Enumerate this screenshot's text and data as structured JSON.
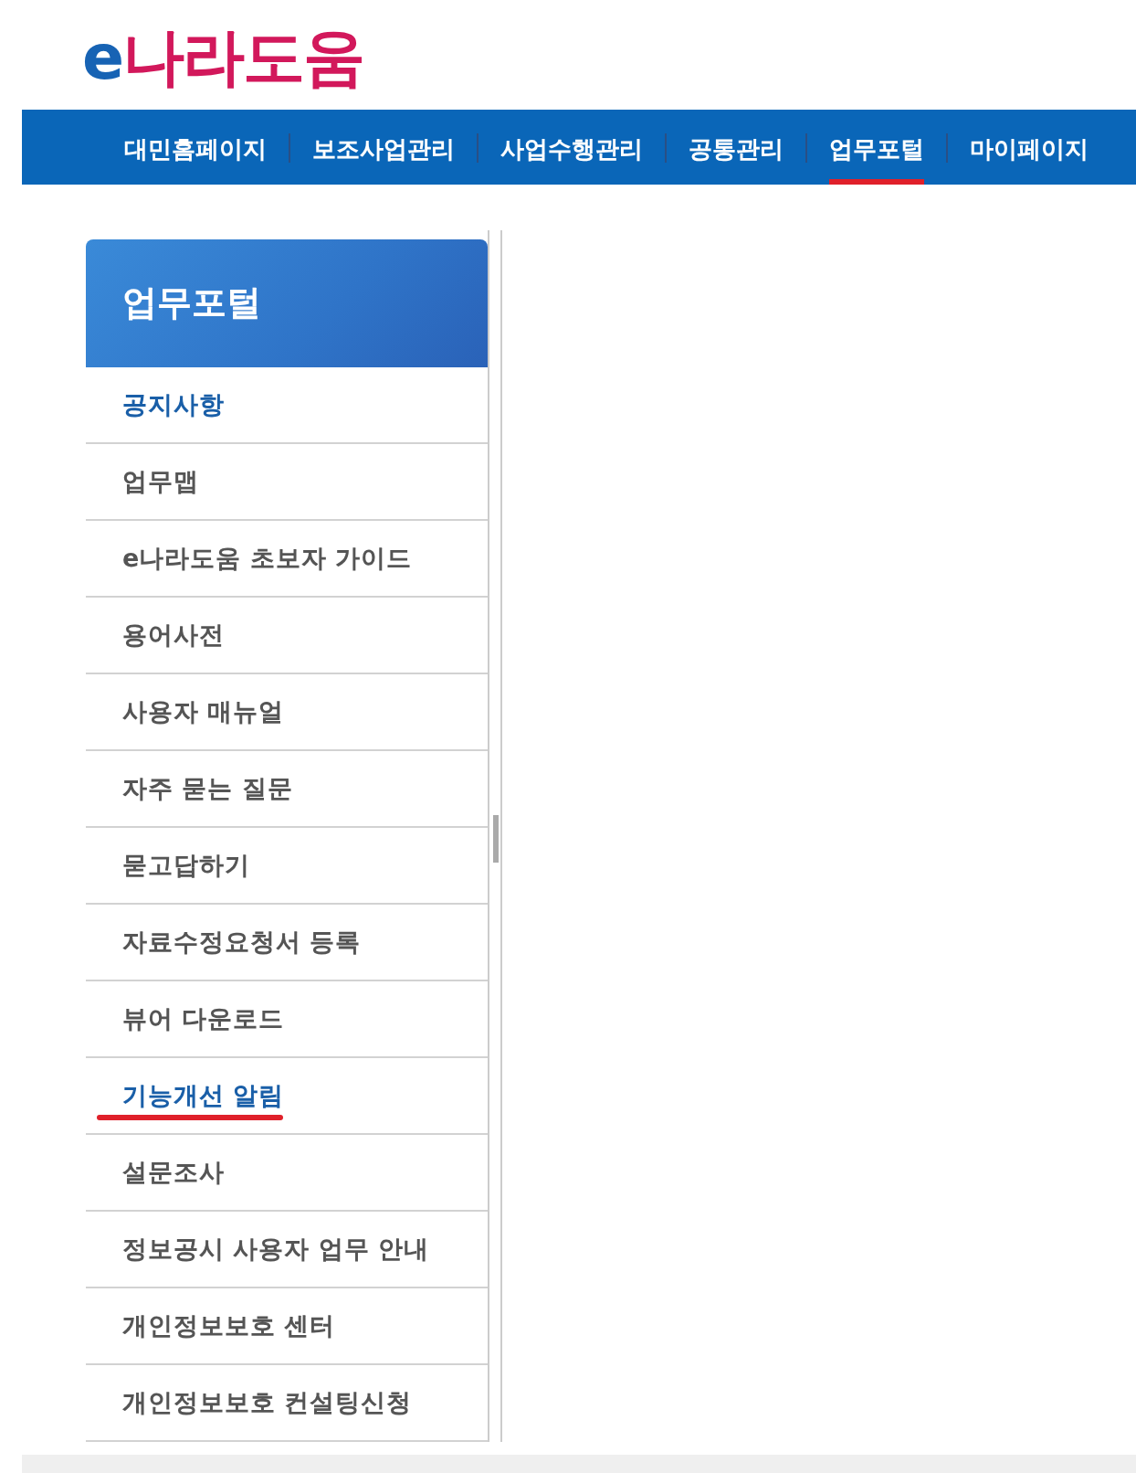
{
  "logo": {
    "text": "e나라도움"
  },
  "nav": [
    {
      "label": "대민홈페이지",
      "selected": false
    },
    {
      "label": "보조사업관리",
      "selected": false
    },
    {
      "label": "사업수행관리",
      "selected": false
    },
    {
      "label": "공통관리",
      "selected": false
    },
    {
      "label": "업무포털",
      "selected": true
    },
    {
      "label": "마이페이지",
      "selected": false
    }
  ],
  "sidebar": {
    "title": "업무포털",
    "items": [
      {
        "label": "공지사항",
        "highlighted": true,
        "underlined": false
      },
      {
        "label": "업무맵",
        "highlighted": false,
        "underlined": false
      },
      {
        "label": "e나라도움 초보자 가이드",
        "highlighted": false,
        "underlined": false
      },
      {
        "label": "용어사전",
        "highlighted": false,
        "underlined": false
      },
      {
        "label": "사용자 매뉴얼",
        "highlighted": false,
        "underlined": false
      },
      {
        "label": "자주 묻는 질문",
        "highlighted": false,
        "underlined": false
      },
      {
        "label": "묻고답하기",
        "highlighted": false,
        "underlined": false
      },
      {
        "label": "자료수정요청서 등록",
        "highlighted": false,
        "underlined": false
      },
      {
        "label": "뷰어 다운로드",
        "highlighted": false,
        "underlined": false
      },
      {
        "label": "기능개선 알림",
        "highlighted": true,
        "underlined": true
      },
      {
        "label": "설문조사",
        "highlighted": false,
        "underlined": false
      },
      {
        "label": "정보공시 사용자 업무 안내",
        "highlighted": false,
        "underlined": false
      },
      {
        "label": "개인정보보호 센터",
        "highlighted": false,
        "underlined": false
      },
      {
        "label": "개인정보보호 컨설팅신청",
        "highlighted": false,
        "underlined": false
      }
    ]
  }
}
